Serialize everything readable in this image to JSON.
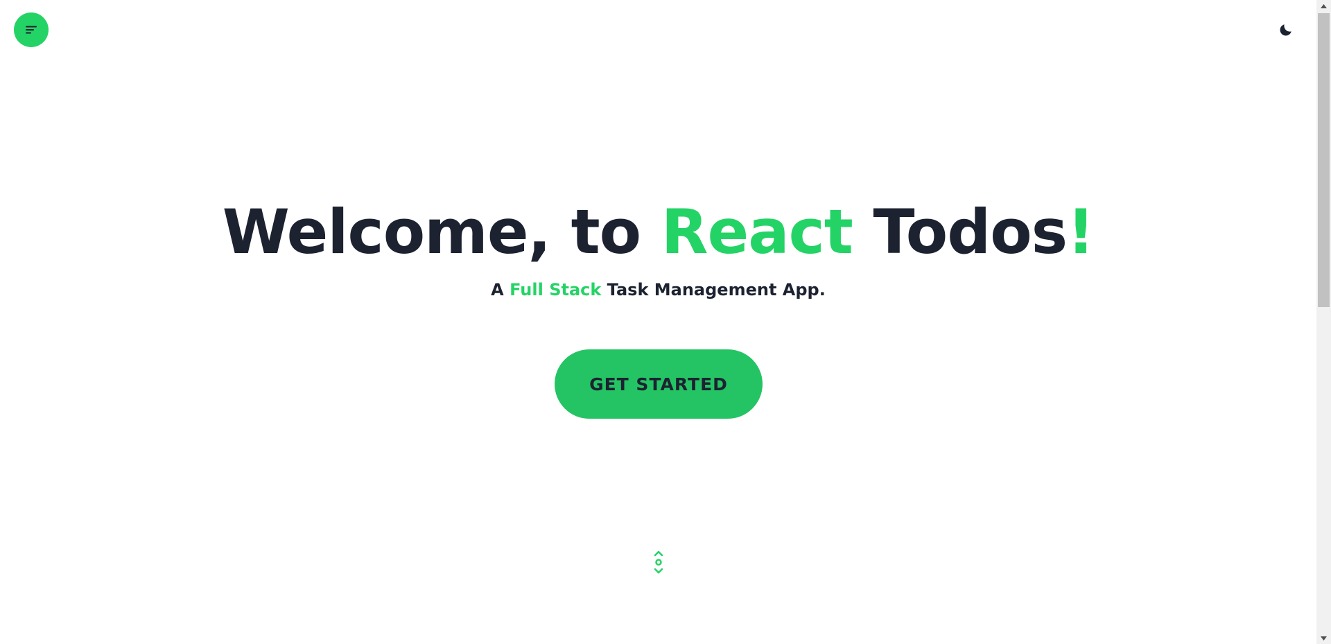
{
  "header": {
    "menu_icon": "menu-lines-icon",
    "theme_icon": "moon-icon"
  },
  "hero": {
    "title_part1": "Welcome, to ",
    "title_accent": "React",
    "title_part2": " Todos",
    "title_exclaim": "!",
    "subtitle_part1": "A ",
    "subtitle_accent": "Full Stack",
    "subtitle_part2": " Task Management App.",
    "cta_label": "GET STARTED"
  },
  "scroll_hint": {
    "icon": "scroll-indicator-icon"
  },
  "colors": {
    "accent": "#24d366",
    "button": "#24c464",
    "text": "#1c2230",
    "background": "#ffffff"
  }
}
